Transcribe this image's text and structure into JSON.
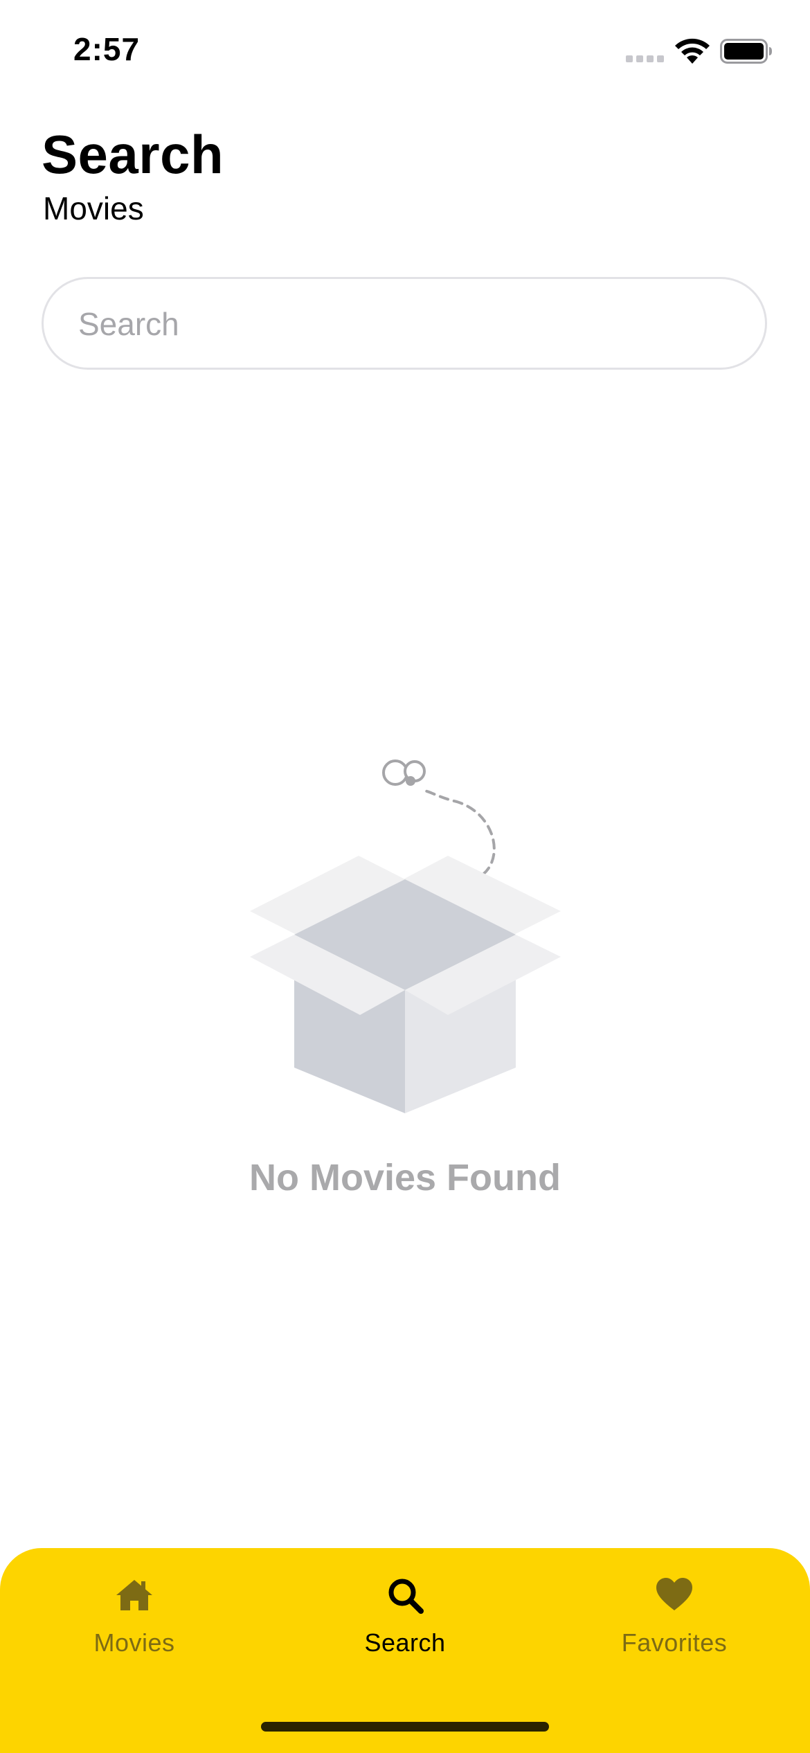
{
  "status_bar": {
    "time": "2:57"
  },
  "header": {
    "title": "Search",
    "subtitle": "Movies"
  },
  "search": {
    "placeholder": "Search",
    "value": ""
  },
  "empty_state": {
    "message": "No Movies Found"
  },
  "tab_bar": {
    "background_color": "#fdd400",
    "tabs": [
      {
        "label": "Movies",
        "icon": "home-icon",
        "active": false
      },
      {
        "label": "Search",
        "icon": "search-icon",
        "active": true
      },
      {
        "label": "Favorites",
        "icon": "heart-icon",
        "active": false
      }
    ]
  }
}
